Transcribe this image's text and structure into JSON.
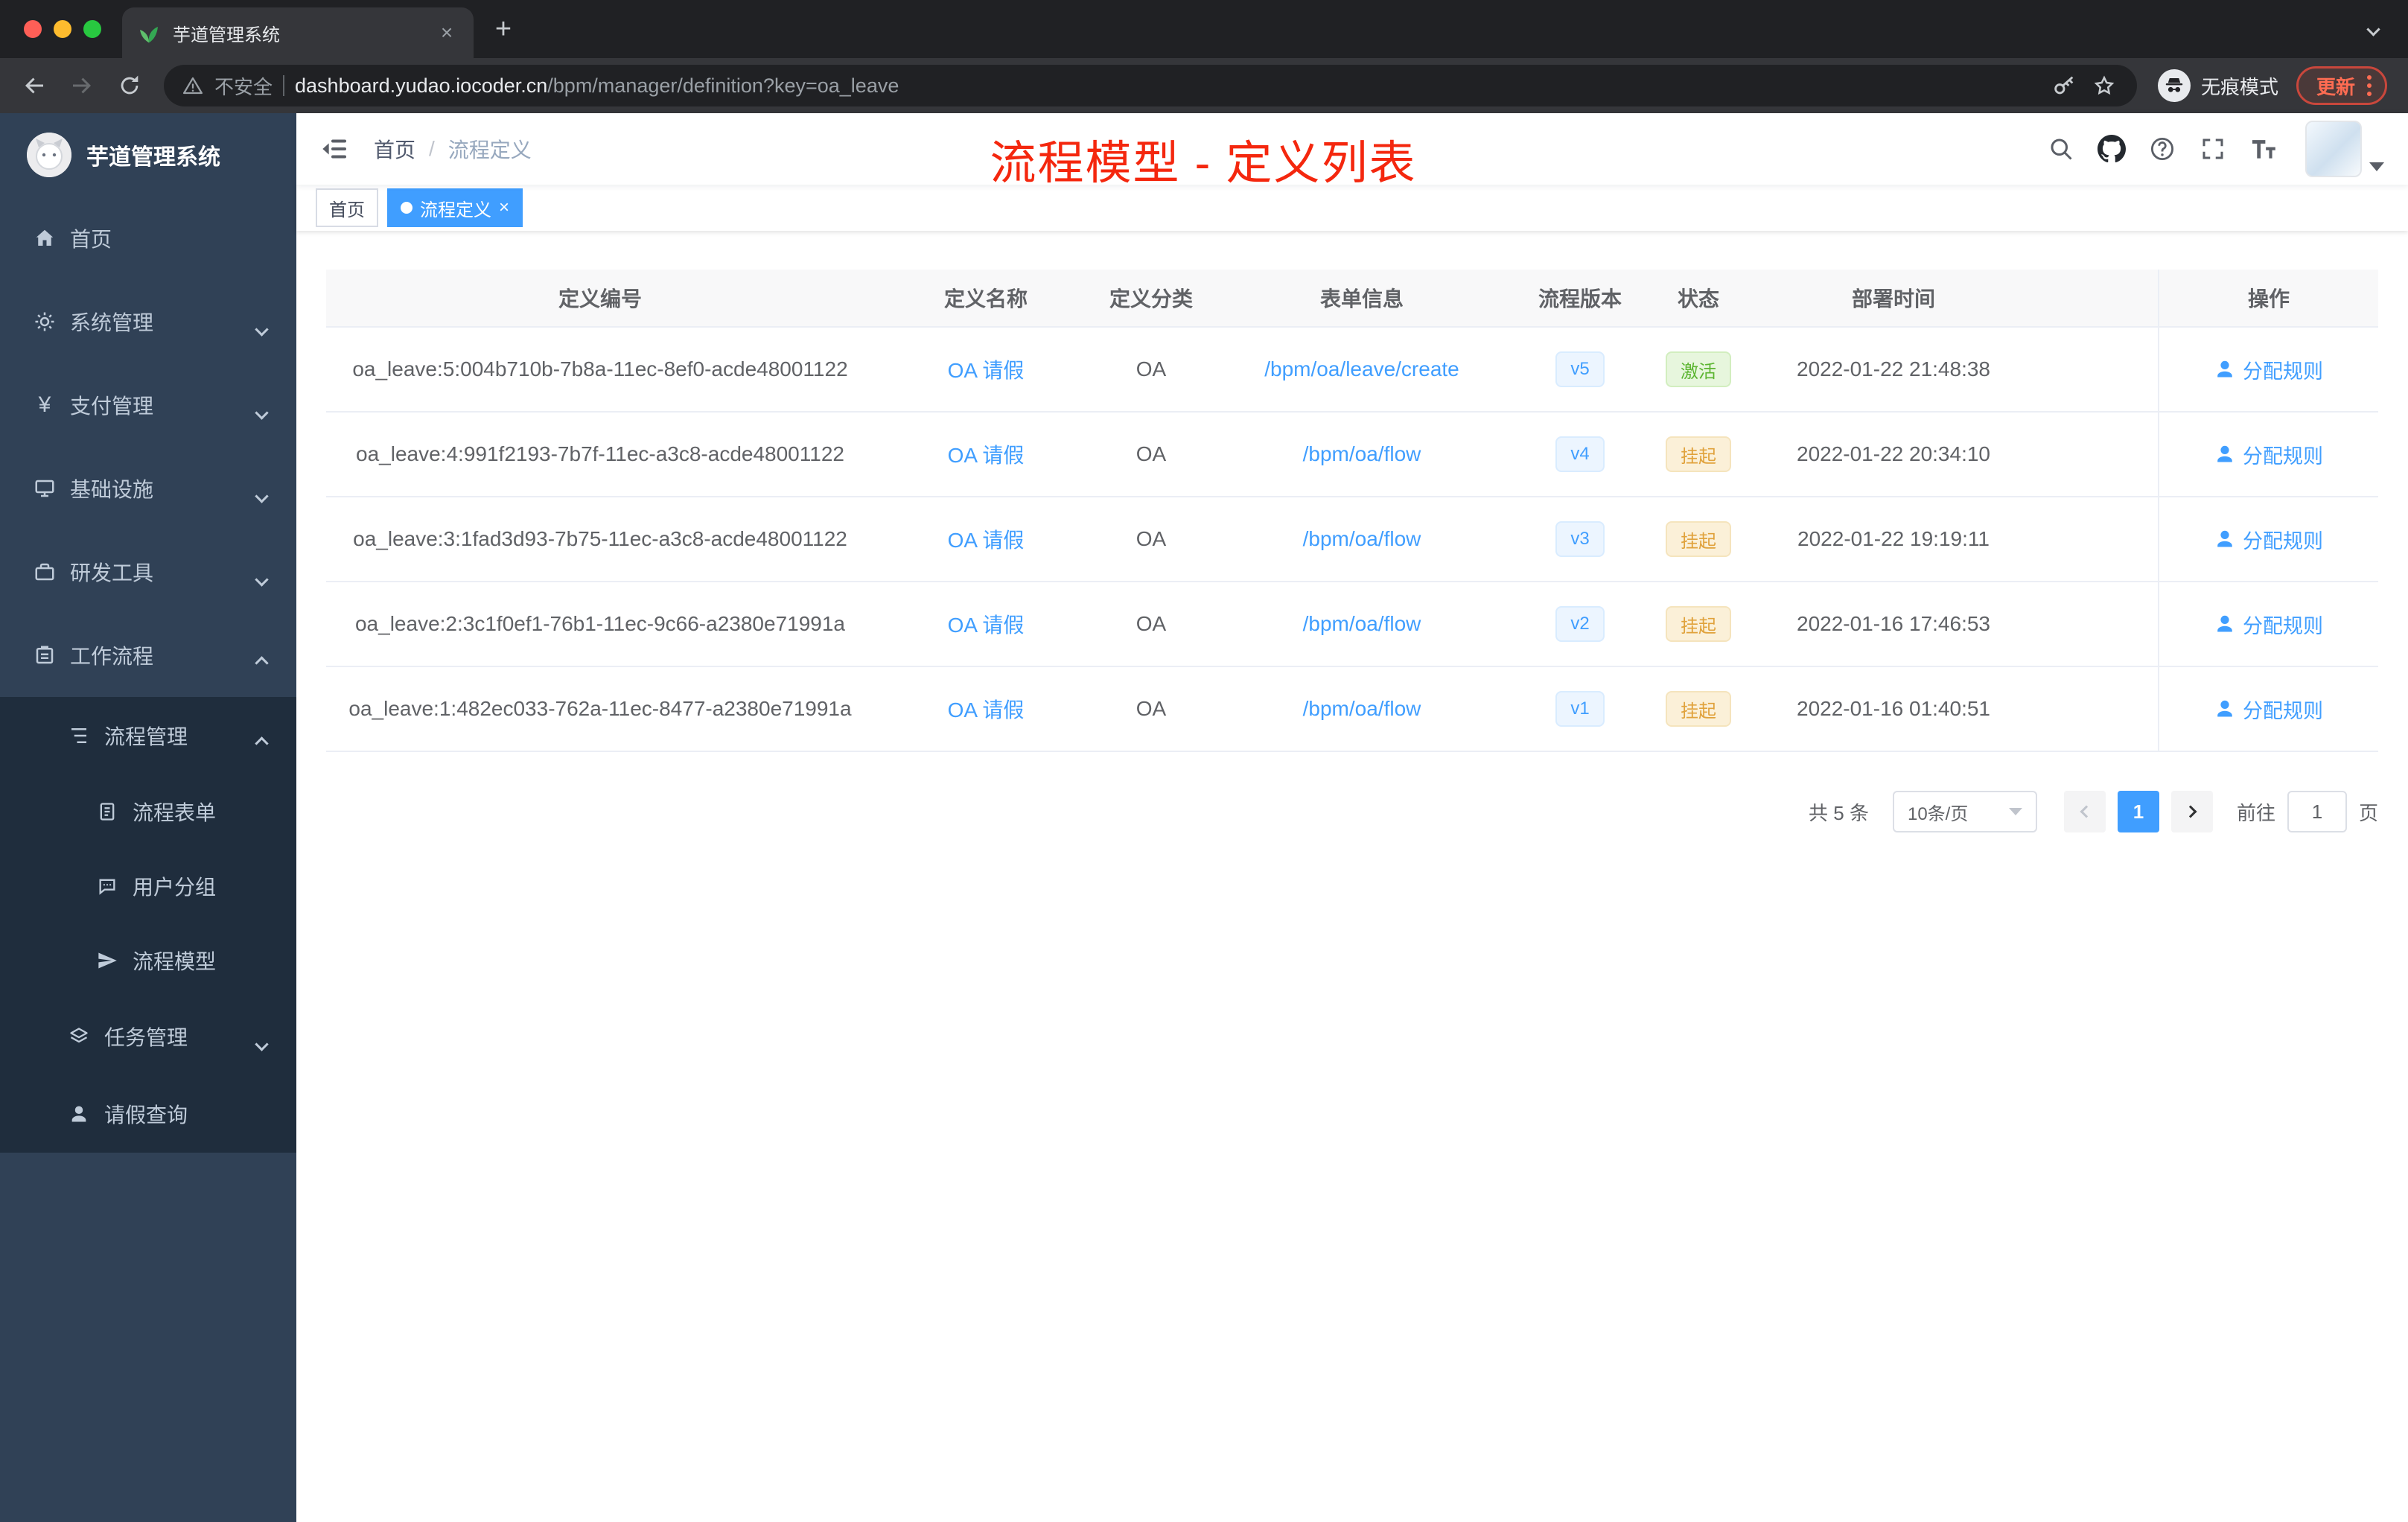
{
  "glyphs": {
    "close_x": "×",
    "plus": "+",
    "yen": "¥"
  },
  "browser": {
    "tab_title": "芋道管理系统",
    "security_label": "不安全",
    "url_host": "dashboard.yudao.iocoder.cn",
    "url_path": "/bpm/manager/definition?key=oa_leave",
    "incognito_label": "无痕模式",
    "update_label": "更新"
  },
  "sidebar": {
    "logo_title": "芋道管理系统",
    "items": [
      {
        "label": "首页"
      },
      {
        "label": "系统管理"
      },
      {
        "label": "支付管理"
      },
      {
        "label": "基础设施"
      },
      {
        "label": "研发工具"
      },
      {
        "label": "工作流程"
      },
      {
        "label": "流程管理"
      },
      {
        "label": "流程表单"
      },
      {
        "label": "用户分组"
      },
      {
        "label": "流程模型"
      },
      {
        "label": "任务管理"
      },
      {
        "label": "请假查询"
      }
    ]
  },
  "header": {
    "breadcrumb": {
      "home": "首页",
      "sep": "/",
      "current": "流程定义"
    },
    "annotation": "流程模型 - 定义列表"
  },
  "tags": {
    "home": "首页",
    "active": "流程定义"
  },
  "table": {
    "columns": [
      "定义编号",
      "定义名称",
      "定义分类",
      "表单信息",
      "流程版本",
      "状态",
      "部署时间",
      "操作"
    ],
    "rows": [
      {
        "id": "oa_leave:5:004b710b-7b8a-11ec-8ef0-acde48001122",
        "name": "OA 请假",
        "category": "OA",
        "form": "/bpm/oa/leave/create",
        "version": "v5",
        "status": "激活",
        "status_type": "success",
        "time": "2022-01-22 21:48:38",
        "action": "分配规则"
      },
      {
        "id": "oa_leave:4:991f2193-7b7f-11ec-a3c8-acde48001122",
        "name": "OA 请假",
        "category": "OA",
        "form": "/bpm/oa/flow",
        "version": "v4",
        "status": "挂起",
        "status_type": "warning",
        "time": "2022-01-22 20:34:10",
        "action": "分配规则"
      },
      {
        "id": "oa_leave:3:1fad3d93-7b75-11ec-a3c8-acde48001122",
        "name": "OA 请假",
        "category": "OA",
        "form": "/bpm/oa/flow",
        "version": "v3",
        "status": "挂起",
        "status_type": "warning",
        "time": "2022-01-22 19:19:11",
        "action": "分配规则"
      },
      {
        "id": "oa_leave:2:3c1f0ef1-76b1-11ec-9c66-a2380e71991a",
        "name": "OA 请假",
        "category": "OA",
        "form": "/bpm/oa/flow",
        "version": "v2",
        "status": "挂起",
        "status_type": "warning",
        "time": "2022-01-16 17:46:53",
        "action": "分配规则"
      },
      {
        "id": "oa_leave:1:482ec033-762a-11ec-8477-a2380e71991a",
        "name": "OA 请假",
        "category": "OA",
        "form": "/bpm/oa/flow",
        "version": "v1",
        "status": "挂起",
        "status_type": "warning",
        "time": "2022-01-16 01:40:51",
        "action": "分配规则"
      }
    ]
  },
  "pagination": {
    "total": "共 5 条",
    "page_size": "10条/页",
    "current_page": "1",
    "goto_label": "前往",
    "goto_value": "1",
    "page_suffix": "页"
  },
  "colors": {
    "accent_blue": "#409eff",
    "annotation_red": "#f4270e",
    "success_green": "#5cb531",
    "warning_orange": "#e0a23c",
    "sidebar_bg": "#304156",
    "submenu_bg": "#1f2d3d"
  }
}
